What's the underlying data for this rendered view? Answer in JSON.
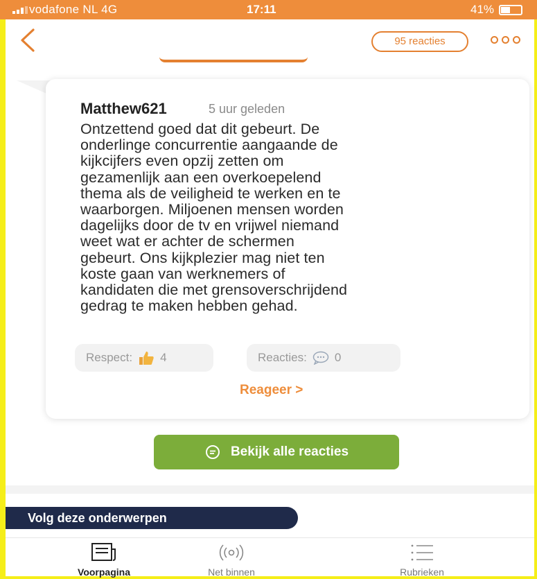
{
  "status_bar": {
    "carrier": "vodafone NL  4G",
    "time": "17:11",
    "battery": "41%"
  },
  "header": {
    "reactions_count_label": "95 reacties"
  },
  "comment": {
    "username": "Matthew621",
    "timestamp": "5 uur geleden",
    "body_lines": [
      "Ontzettend goed dat dit gebeurt. De",
      "onderlinge concurrentie aangaande de",
      "kijkcijfers even opzij zetten om",
      "gezamenlijk aan een overkoepelend",
      "thema als de veiligheid te werken en te",
      "waarborgen. Miljoenen mensen worden",
      "dagelijks door de tv en vrijwel niemand",
      "weet wat er achter de schermen",
      "gebeurt. Ons kijkplezier mag niet ten",
      "koste gaan van werknemers of",
      "kandidaten die met grensoverschrijdend",
      "gedrag te maken hebben gehad."
    ],
    "respect_label": "Respect:",
    "respect_count": "4",
    "replies_label": "Reacties:",
    "replies_count": "0",
    "reply_link": "Reageer >"
  },
  "view_all_button": "Bekijk alle reacties",
  "follow_topics": "Volg deze onderwerpen",
  "bottom_nav": [
    {
      "label": "Voorpagina",
      "icon": "newspaper-icon",
      "active": true
    },
    {
      "label": "Net binnen",
      "icon": "broadcast-icon",
      "active": false
    },
    {
      "label": "Rubrieken",
      "icon": "list-icon",
      "active": false
    }
  ],
  "colors": {
    "accent": "#ee8d3b",
    "frame": "#f5ee19",
    "button_green": "#7cad3a",
    "navy": "#1f2a4a"
  }
}
